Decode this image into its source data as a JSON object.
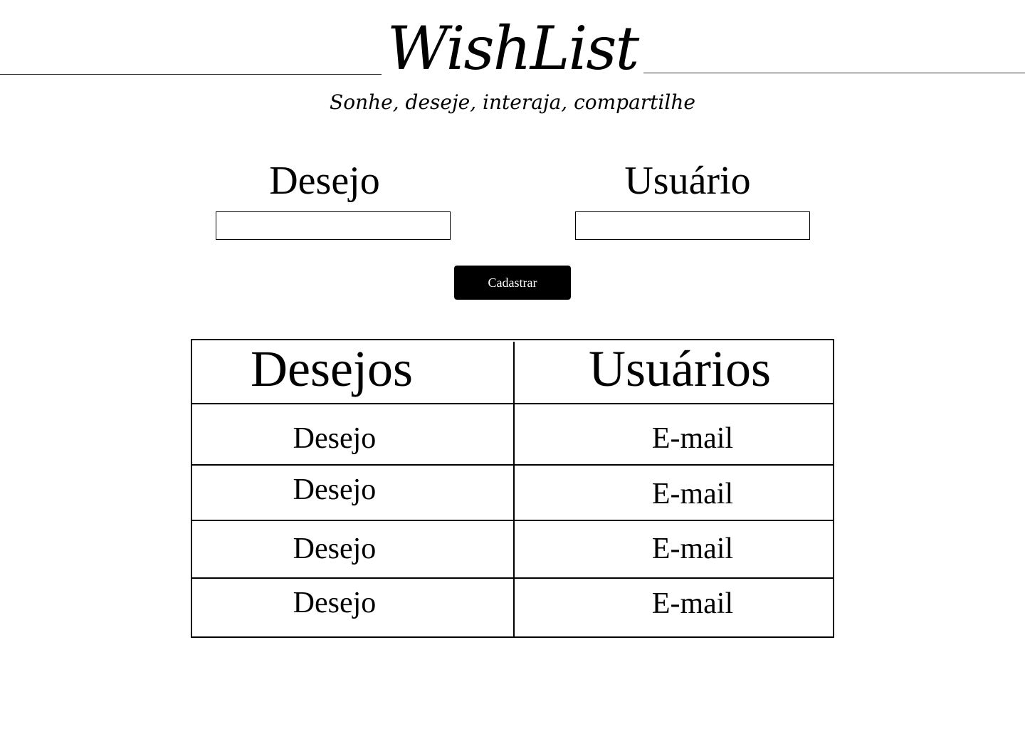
{
  "header": {
    "logo": "WishList",
    "tagline": "Sonhe, deseje, interaja, compartilhe"
  },
  "form": {
    "desejo_label": "Desejo",
    "desejo_value": "",
    "usuario_label": "Usuário",
    "usuario_value": "",
    "submit_label": "Cadastrar"
  },
  "table": {
    "headers": [
      "Desejos",
      "Usuários"
    ],
    "rows": [
      [
        "Desejo",
        "E-mail"
      ],
      [
        "Desejo",
        "E-mail"
      ],
      [
        "Desejo",
        "E-mail"
      ],
      [
        "Desejo",
        "E-mail"
      ]
    ]
  }
}
